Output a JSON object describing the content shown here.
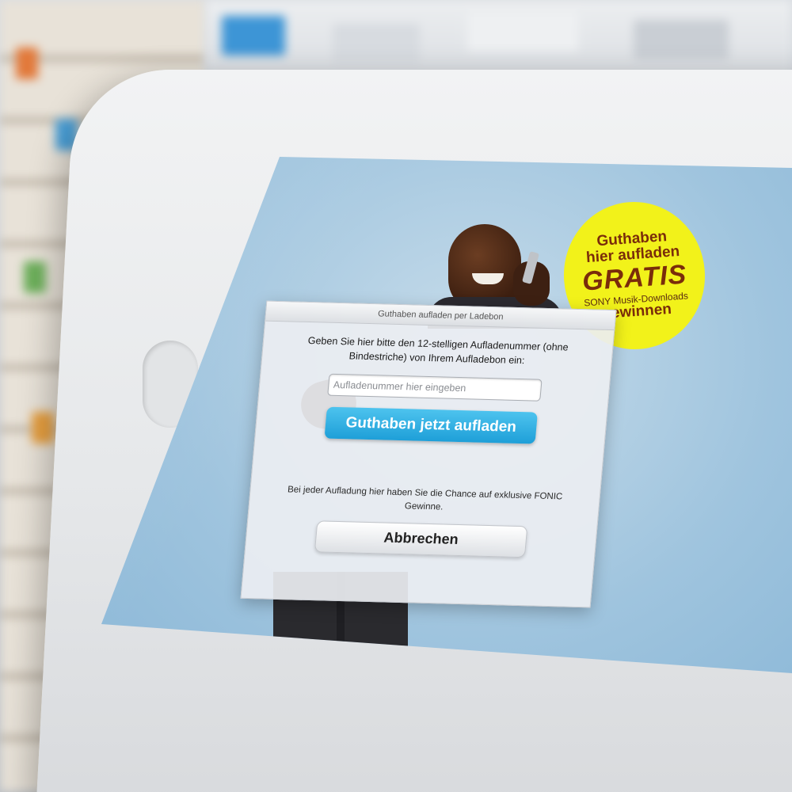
{
  "badge": {
    "line1": "Guthaben",
    "line2": "hier aufladen",
    "line3": "GRATIS",
    "line4": "SONY Musik-Downloads",
    "line5": "gewinnen"
  },
  "dialog": {
    "title": "Guthaben aufladen per Ladebon",
    "instruction": "Geben Sie hier bitte den 12-stelligen Aufladenummer (ohne Bindestriche) von Ihrem Aufladebon ein:",
    "input_placeholder": "Aufladenummer hier eingeben",
    "topup_label": "Guthaben jetzt aufladen",
    "promo_text": "Bei jeder Aufladung hier haben Sie die Chance auf exklusive FONIC Gewinne.",
    "cancel_label": "Abbrechen"
  },
  "colors": {
    "badge_yellow": "#f2f21a",
    "badge_text": "#7a2c0a",
    "primary_button": "#1e9fd8",
    "screen_background": "#9fc4de"
  }
}
